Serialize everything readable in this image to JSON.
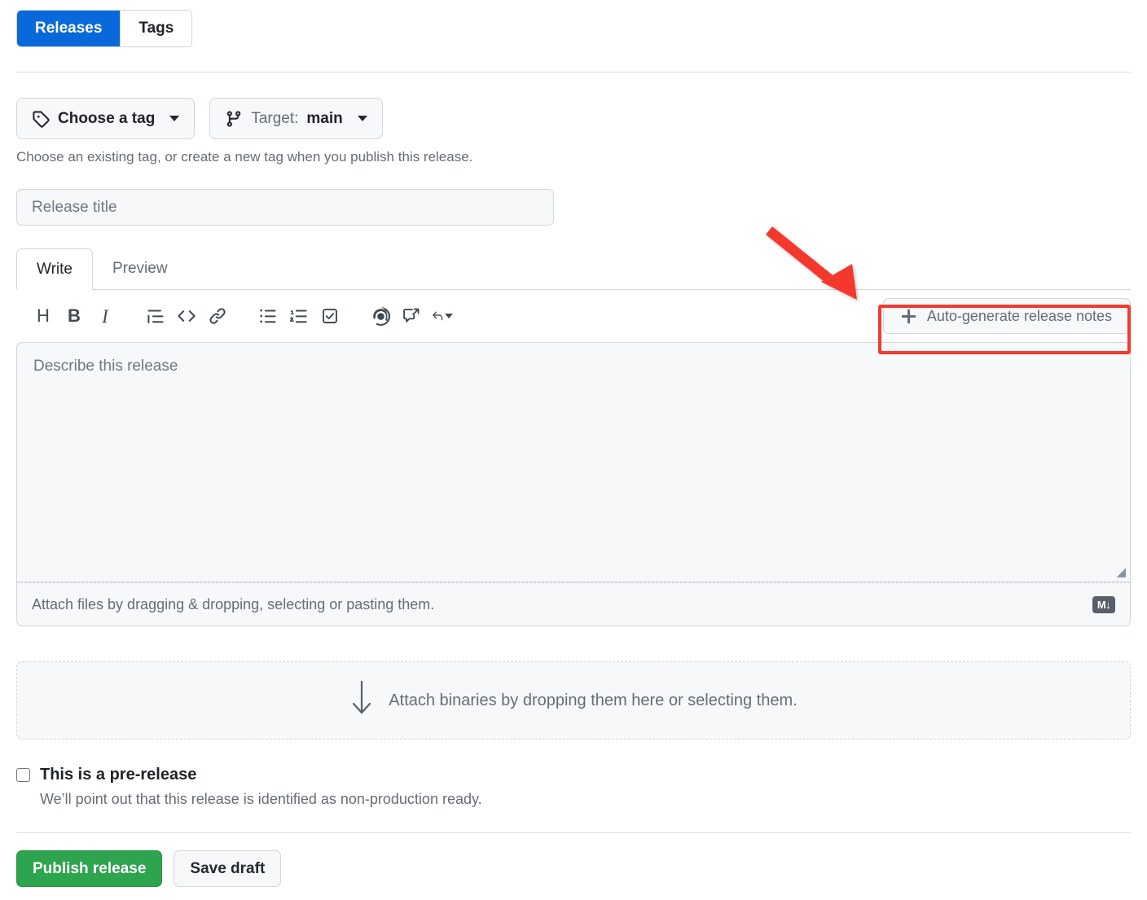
{
  "tabs": {
    "releases_label": "Releases",
    "tags_label": "Tags"
  },
  "tag_row": {
    "choose_tag_label": "Choose a tag",
    "target_prefix": "Target:",
    "target_value": "main",
    "helper_text": "Choose an existing tag, or create a new tag when you publish this release."
  },
  "release_title": {
    "value": "",
    "placeholder": "Release title"
  },
  "editor": {
    "tabs": [
      {
        "label": "Write",
        "active": true
      },
      {
        "label": "Preview",
        "active": false
      }
    ],
    "toolbar_icons": [
      "heading-icon",
      "bold-icon",
      "italic-icon",
      "quote-icon",
      "code-icon",
      "link-icon",
      "unordered-list-icon",
      "ordered-list-icon",
      "task-list-icon",
      "mention-icon",
      "reference-icon",
      "reply-icon"
    ],
    "autogen_button_label": "Auto-generate release notes",
    "body": {
      "value": "",
      "placeholder": "Describe this release"
    },
    "footer_text": "Attach files by dragging & dropping, selecting or pasting them.",
    "markdown_badge": "M↓"
  },
  "dropzone": {
    "text": "Attach binaries by dropping them here or selecting them."
  },
  "prerelease": {
    "label": "This is a pre-release",
    "description": "We’ll point out that this release is identified as non-production ready.",
    "checked": false
  },
  "actions": {
    "publish_label": "Publish release",
    "save_draft_label": "Save draft"
  },
  "annotation": {
    "arrow_color": "#f5392e",
    "highlight_color": "#f5392e",
    "target": "auto-generate-release-notes-button"
  },
  "colors": {
    "accent_blue": "#0969da",
    "success_green": "#2da44e",
    "border": "#d0d7de",
    "surface": "#f6f8fa",
    "text": "#1f2328",
    "muted_text": "#656d76"
  }
}
